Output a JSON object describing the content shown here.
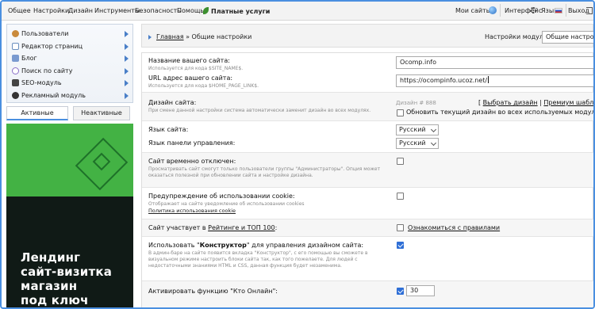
{
  "topbar": {
    "left": [
      "Общее",
      "Настройки",
      "Дизайн",
      "Инструменты",
      "Безопасность",
      "Помощь"
    ],
    "paid": "Платные услуги",
    "my_sites": "Мои сайты",
    "interface": "Интерфейс",
    "language": "Язык",
    "exit": "Выход"
  },
  "sidebar": {
    "items": [
      {
        "label": "Пользователи",
        "icon": "users-icon",
        "color": "#c98a3c"
      },
      {
        "label": "Редактор страниц",
        "icon": "page-editor-icon",
        "color": "#6a8fbf"
      },
      {
        "label": "Блог",
        "icon": "blog-icon",
        "color": "#7a9ad0"
      },
      {
        "label": "Поиск по сайту",
        "icon": "search-icon",
        "color": "#8a6fc8"
      },
      {
        "label": "SEO-модуль",
        "icon": "seo-icon",
        "color": "#444444"
      },
      {
        "label": "Рекламный модуль",
        "icon": "ad-module-icon",
        "color": "#333333"
      }
    ],
    "tab_active": "Активные",
    "tab_inactive": "Неактивные",
    "banner_lines": [
      "Лендинг",
      "сайт-визитка",
      "магазин",
      "под ключ"
    ]
  },
  "breadcrumb": {
    "home": "Главная",
    "sep": " » ",
    "current": "Общие настройки"
  },
  "module_settings": {
    "label": "Настройки модуля:",
    "value": "Общие настрой"
  },
  "settings": {
    "site_name": {
      "label": "Название вашего сайта:",
      "hint": "Используется для кода $SITE_NAME$.",
      "value": "Ocomp.info"
    },
    "site_url": {
      "label": "URL адрес вашего сайта:",
      "hint": "Используется для кода $HOME_PAGE_LINK$.",
      "value": "https://ocompinfo.ucoz.net/"
    },
    "design": {
      "label": "Дизайн сайта:",
      "hint": "При смене данной настройки система автоматически заменит дизайн во всех модулях.",
      "design_no": "Дизайн # 888",
      "choose": "Выбрать дизайн",
      "premium": "Премиум шаблоны",
      "update_label": "Обновить текущий дизайн во всех используемых модулях"
    },
    "site_lang": {
      "label": "Язык сайта:",
      "value": "Русский"
    },
    "panel_lang": {
      "label": "Язык панели управления:",
      "value": "Русский"
    },
    "disabled": {
      "label": "Сайт временно отключен:",
      "hint": "Просматривать сайт смогут только пользователи группы \"Администраторы\". Опция может оказаться полезной при обновлении сайта и настройке дизайна."
    },
    "cookie": {
      "label": "Предупреждение об использовании cookie:",
      "hint": "Отображает на сайте уведомление об использовании cookies",
      "policy": "Политика использования cookie"
    },
    "rating": {
      "label_pre": "Сайт участвует в ",
      "label_link": "Рейтинге и ТОП 100",
      "label_post": ":",
      "rules": "Ознакомиться с правилами"
    },
    "constructor": {
      "label_pre": "Использовать \"",
      "label_bold": "Конструктор",
      "label_post": "\" для управления дизайном сайта:",
      "hint": "В админ-баре на сайте появится вкладка \"Конструктор\", с его помощью вы сможете в визуальном режиме настроить блоки сайта так, как того пожелаете. Для людей с недостаточными знаниями HTML и CSS, данная функция будет незаменима."
    },
    "online": {
      "label": "Активировать функцию \"Кто Онлайн\":",
      "value": "30"
    }
  },
  "colors": {
    "accent": "#4a8fe0",
    "banner_green": "#43b244",
    "banner_dark": "#101a16",
    "checkbox_on": "#2f6fd6"
  }
}
